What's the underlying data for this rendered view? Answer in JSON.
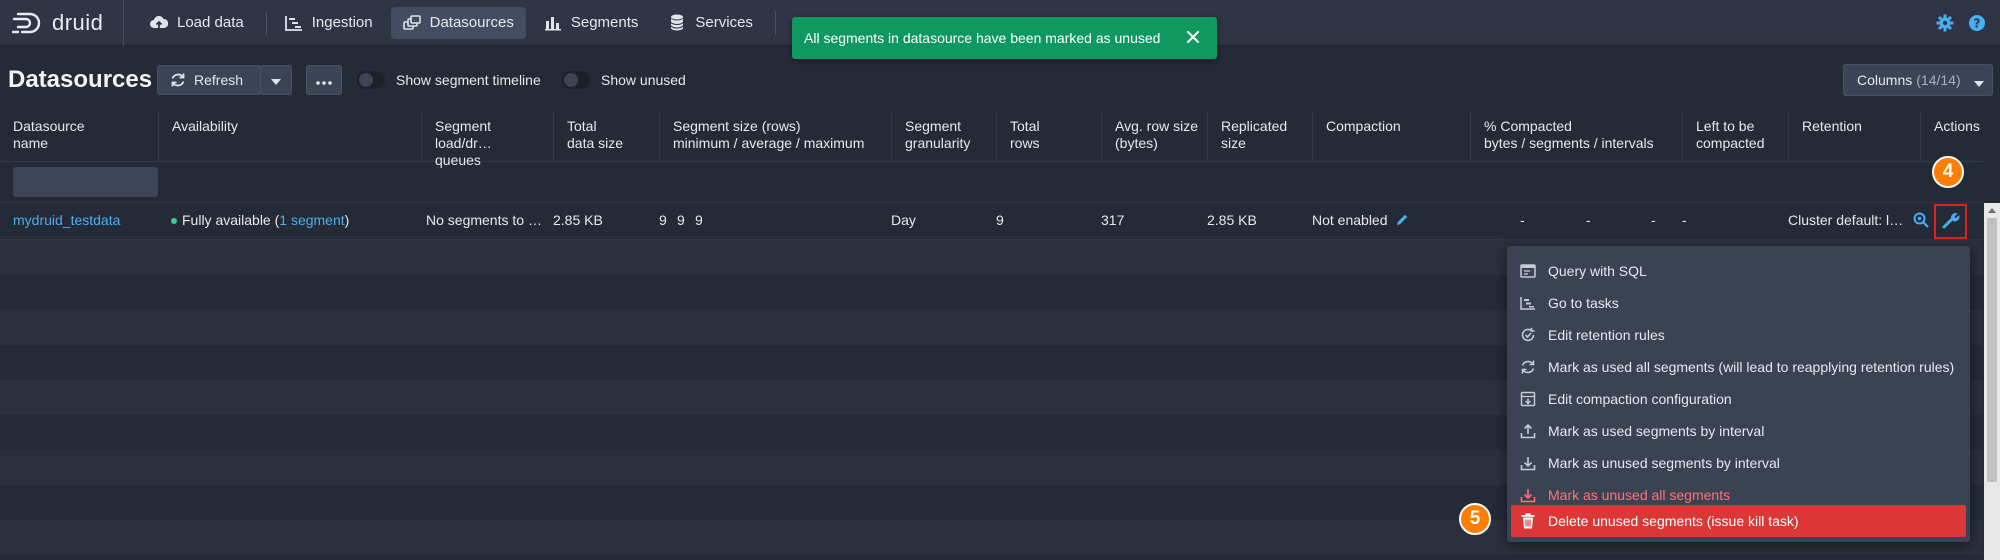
{
  "nav": {
    "logo_text": "druid",
    "items": [
      {
        "label": "Load data",
        "icon": "cloud-upload-icon"
      },
      {
        "label": "Ingestion",
        "icon": "gantt-chart-icon"
      },
      {
        "label": "Datasources",
        "icon": "multi-select-icon",
        "active": true
      },
      {
        "label": "Segments",
        "icon": "stacked-chart-icon"
      },
      {
        "label": "Services",
        "icon": "database-icon"
      }
    ],
    "right_icons": [
      "cog-icon",
      "help-icon"
    ]
  },
  "toast": {
    "message": "All segments in datasource have been marked as unused",
    "color": "#0f9960"
  },
  "header": {
    "title": "Datasources",
    "refresh_label": "Refresh",
    "show_timeline_label": "Show segment timeline",
    "show_unused_label": "Show unused",
    "columns_label": "Columns",
    "columns_count": "(14/14)"
  },
  "table": {
    "headers": [
      [
        "Datasource",
        "name"
      ],
      [
        "Availability",
        ""
      ],
      [
        "Segment load/dr…",
        "queues"
      ],
      [
        "Total",
        "data size"
      ],
      [
        "Segment size (rows)",
        "minimum / average / maximum"
      ],
      [
        "Segment",
        "granularity"
      ],
      [
        "Total",
        "rows"
      ],
      [
        "Avg. row size",
        "(bytes)"
      ],
      [
        "Replicated",
        "size"
      ],
      [
        "Compaction",
        ""
      ],
      [
        "% Compacted",
        "bytes / segments / intervals"
      ],
      [
        "Left to be",
        "compacted"
      ],
      [
        "Retention",
        ""
      ],
      [
        "Actions",
        ""
      ]
    ],
    "row": {
      "datasource": "mydruid_testdata",
      "availability_prefix": "Fully available (",
      "availability_link": "1 segment",
      "availability_suffix": ")",
      "load_queue": "No segments to …",
      "total_size": "2.85 KB",
      "seg_min": "9",
      "seg_avg": "9",
      "seg_max": "9",
      "granularity": "Day",
      "total_rows": "9",
      "avg_row_size": "317",
      "replicated_size": "2.85 KB",
      "compaction": "Not enabled",
      "pct_bytes": "-",
      "pct_segments": "-",
      "pct_intervals": "-",
      "left_to_compact": "-",
      "retention": "Cluster default: l…"
    }
  },
  "badges": {
    "step4": "4",
    "step5": "5"
  },
  "menu": {
    "items": [
      {
        "label": "Query with SQL",
        "icon": "application-icon"
      },
      {
        "label": "Go to tasks",
        "icon": "gantt-chart-icon"
      },
      {
        "label": "Edit retention rules",
        "icon": "automatic-updates-icon"
      },
      {
        "label": "Mark as used all segments (will lead to reapplying retention rules)",
        "icon": "refresh-icon"
      },
      {
        "label": "Edit compaction configuration",
        "icon": "compressed-icon"
      },
      {
        "label": "Mark as used segments by interval",
        "icon": "upload-icon"
      },
      {
        "label": "Mark as unused segments by interval",
        "icon": "download-icon"
      },
      {
        "label": "Mark as unused all segments",
        "icon": "download-icon",
        "style": "danger-text"
      },
      {
        "label": "Delete unused segments (issue kill task)",
        "icon": "trash-icon",
        "style": "danger"
      }
    ]
  },
  "colors": {
    "accent_link": "#48aff0",
    "danger": "#db3737",
    "badge": "#ff7d00",
    "available_dot": "#3dcc91"
  }
}
